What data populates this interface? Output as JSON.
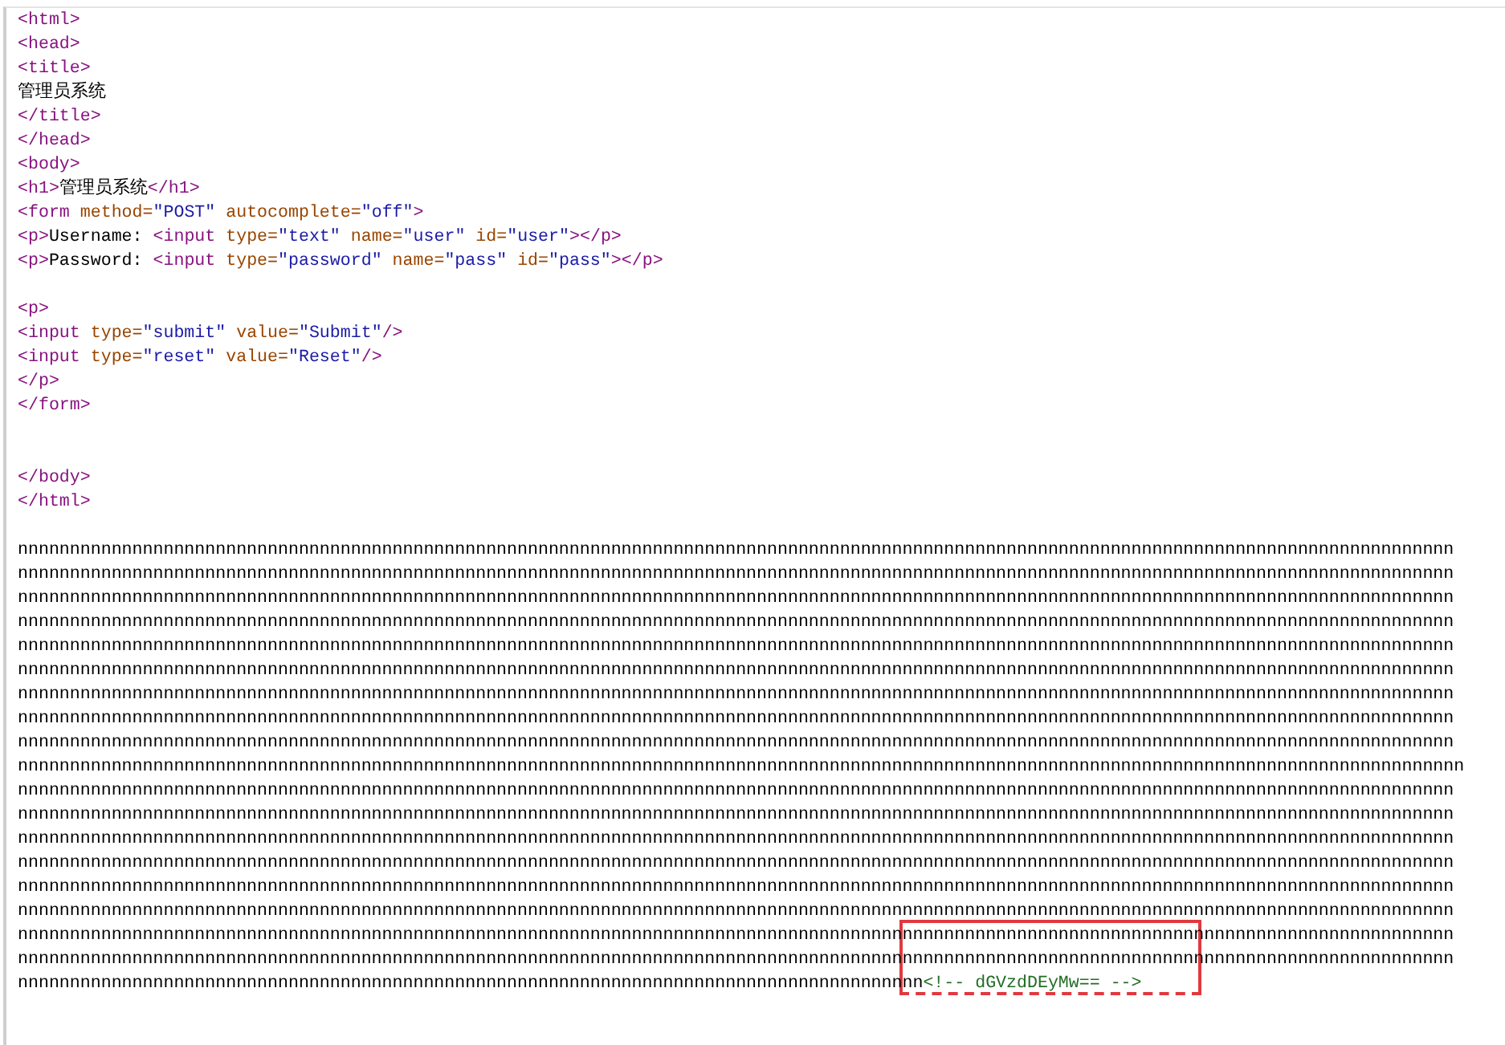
{
  "source_lines": [
    {
      "kind": "code",
      "tokens": [
        {
          "kind": "tag",
          "text": "<html>"
        }
      ]
    },
    {
      "kind": "code",
      "tokens": [
        {
          "kind": "tag",
          "text": "<head>"
        }
      ]
    },
    {
      "kind": "code",
      "tokens": [
        {
          "kind": "tag",
          "text": "<title>"
        }
      ]
    },
    {
      "kind": "code",
      "tokens": [
        {
          "kind": "text",
          "text": "管理员系统"
        }
      ]
    },
    {
      "kind": "code",
      "tokens": [
        {
          "kind": "tag",
          "text": "</title>"
        }
      ]
    },
    {
      "kind": "code",
      "tokens": [
        {
          "kind": "tag",
          "text": "</head>"
        }
      ]
    },
    {
      "kind": "code",
      "tokens": [
        {
          "kind": "tag",
          "text": "<body>"
        }
      ]
    },
    {
      "kind": "code",
      "tokens": [
        {
          "kind": "tag",
          "text": "<h1>"
        },
        {
          "kind": "text",
          "text": "管理员系统"
        },
        {
          "kind": "tag",
          "text": "</h1>"
        }
      ]
    },
    {
      "kind": "code",
      "tokens": [
        {
          "kind": "tag",
          "text": "<form "
        },
        {
          "kind": "attr",
          "text": "method="
        },
        {
          "kind": "value",
          "text": "\"POST\""
        },
        {
          "kind": "attr",
          "text": " autocomplete="
        },
        {
          "kind": "value",
          "text": "\"off\""
        },
        {
          "kind": "tag",
          "text": ">"
        }
      ]
    },
    {
      "kind": "code",
      "tokens": [
        {
          "kind": "tag",
          "text": "<p>"
        },
        {
          "kind": "text",
          "text": "Username: "
        },
        {
          "kind": "tag",
          "text": "<input "
        },
        {
          "kind": "attr",
          "text": "type="
        },
        {
          "kind": "value",
          "text": "\"text\""
        },
        {
          "kind": "attr",
          "text": " name="
        },
        {
          "kind": "value",
          "text": "\"user\""
        },
        {
          "kind": "attr",
          "text": " id="
        },
        {
          "kind": "value",
          "text": "\"user\""
        },
        {
          "kind": "tag",
          "text": "></p>"
        }
      ]
    },
    {
      "kind": "code",
      "tokens": [
        {
          "kind": "tag",
          "text": "<p>"
        },
        {
          "kind": "text",
          "text": "Password: "
        },
        {
          "kind": "tag",
          "text": "<input "
        },
        {
          "kind": "attr",
          "text": "type="
        },
        {
          "kind": "value",
          "text": "\"password\""
        },
        {
          "kind": "attr",
          "text": " name="
        },
        {
          "kind": "value",
          "text": "\"pass\""
        },
        {
          "kind": "attr",
          "text": " id="
        },
        {
          "kind": "value",
          "text": "\"pass\""
        },
        {
          "kind": "tag",
          "text": "></p>"
        }
      ]
    },
    {
      "kind": "blank"
    },
    {
      "kind": "code",
      "tokens": [
        {
          "kind": "tag",
          "text": "<p>"
        }
      ]
    },
    {
      "kind": "code",
      "tokens": [
        {
          "kind": "tag",
          "text": "<input "
        },
        {
          "kind": "attr",
          "text": "type="
        },
        {
          "kind": "value",
          "text": "\"submit\""
        },
        {
          "kind": "attr",
          "text": " value="
        },
        {
          "kind": "value",
          "text": "\"Submit\""
        },
        {
          "kind": "tag",
          "text": "/>"
        }
      ]
    },
    {
      "kind": "code",
      "tokens": [
        {
          "kind": "tag",
          "text": "<input "
        },
        {
          "kind": "attr",
          "text": "type="
        },
        {
          "kind": "value",
          "text": "\"reset\""
        },
        {
          "kind": "attr",
          "text": " value="
        },
        {
          "kind": "value",
          "text": "\"Reset\""
        },
        {
          "kind": "tag",
          "text": "/>"
        }
      ]
    },
    {
      "kind": "code",
      "tokens": [
        {
          "kind": "tag",
          "text": "</p>"
        }
      ]
    },
    {
      "kind": "code",
      "tokens": [
        {
          "kind": "tag",
          "text": "</form>"
        }
      ]
    },
    {
      "kind": "blank"
    },
    {
      "kind": "blank"
    },
    {
      "kind": "code",
      "tokens": [
        {
          "kind": "tag",
          "text": "</body>"
        }
      ]
    },
    {
      "kind": "code",
      "tokens": [
        {
          "kind": "tag",
          "text": "</html>"
        }
      ]
    },
    {
      "kind": "blank"
    },
    {
      "kind": "code",
      "tokens": [
        {
          "kind": "text",
          "text": "nnnnnnnnnnnnnnnnnnnnnnnnnnnnnnnnnnnnnnnnnnnnnnnnnnnnnnnnnnnnnnnnnnnnnnnnnnnnnnnnnnnnnnnnnnnnnnnnnnnnnnnnnnnnnnnnnnnnnnnnnnnnnnnnnnnnnnnnnn"
        }
      ]
    },
    {
      "kind": "code",
      "tokens": [
        {
          "kind": "text",
          "text": "nnnnnnnnnnnnnnnnnnnnnnnnnnnnnnnnnnnnnnnnnnnnnnnnnnnnnnnnnnnnnnnnnnnnnnnnnnnnnnnnnnnnnnnnnnnnnnnnnnnnnnnnnnnnnnnnnnnnnnnnnnnnnnnnnnnnnnnnnn"
        }
      ]
    },
    {
      "kind": "code",
      "tokens": [
        {
          "kind": "text",
          "text": "nnnnnnnnnnnnnnnnnnnnnnnnnnnnnnnnnnnnnnnnnnnnnnnnnnnnnnnnnnnnnnnnnnnnnnnnnnnnnnnnnnnnnnnnnnnnnnnnnnnnnnnnnnnnnnnnnnnnnnnnnnnnnnnnnnnnnnnnnn"
        }
      ]
    },
    {
      "kind": "code",
      "tokens": [
        {
          "kind": "text",
          "text": "nnnnnnnnnnnnnnnnnnnnnnnnnnnnnnnnnnnnnnnnnnnnnnnnnnnnnnnnnnnnnnnnnnnnnnnnnnnnnnnnnnnnnnnnnnnnnnnnnnnnnnnnnnnnnnnnnnnnnnnnnnnnnnnnnnnnnnnnnn"
        }
      ]
    },
    {
      "kind": "code",
      "tokens": [
        {
          "kind": "text",
          "text": "nnnnnnnnnnnnnnnnnnnnnnnnnnnnnnnnnnnnnnnnnnnnnnnnnnnnnnnnnnnnnnnnnnnnnnnnnnnnnnnnnnnnnnnnnnnnnnnnnnnnnnnnnnnnnnnnnnnnnnnnnnnnnnnnnnnnnnnnnn"
        }
      ]
    },
    {
      "kind": "code",
      "tokens": [
        {
          "kind": "text",
          "text": "nnnnnnnnnnnnnnnnnnnnnnnnnnnnnnnnnnnnnnnnnnnnnnnnnnnnnnnnnnnnnnnnnnnnnnnnnnnnnnnnnnnnnnnnnnnnnnnnnnnnnnnnnnnnnnnnnnnnnnnnnnnnnnnnnnnnnnnnnn"
        }
      ]
    },
    {
      "kind": "code",
      "tokens": [
        {
          "kind": "text",
          "text": "nnnnnnnnnnnnnnnnnnnnnnnnnnnnnnnnnnnnnnnnnnnnnnnnnnnnnnnnnnnnnnnnnnnnnnnnnnnnnnnnnnnnnnnnnnnnnnnnnnnnnnnnnnnnnnnnnnnnnnnnnnnnnnnnnnnnnnnnnn"
        }
      ]
    },
    {
      "kind": "code",
      "tokens": [
        {
          "kind": "text",
          "text": "nnnnnnnnnnnnnnnnnnnnnnnnnnnnnnnnnnnnnnnnnnnnnnnnnnnnnnnnnnnnnnnnnnnnnnnnnnnnnnnnnnnnnnnnnnnnnnnnnnnnnnnnnnnnnnnnnnnnnnnnnnnnnnnnnnnnnnnnnn"
        }
      ]
    },
    {
      "kind": "code",
      "tokens": [
        {
          "kind": "text",
          "text": "nnnnnnnnnnnnnnnnnnnnnnnnnnnnnnnnnnnnnnnnnnnnnnnnnnnnnnnnnnnnnnnnnnnnnnnnnnnnnnnnnnnnnnnnnnnnnnnnnnnnnnnnnnnnnnnnnnnnnnnnnnnnnnnnnnnnnnnnnn"
        }
      ]
    },
    {
      "kind": "code",
      "tokens": [
        {
          "kind": "text",
          "text": "nnnnnnnnnnnnnnnnnnnnnnnnnnnnnnnnnnnnnnnnnnnnnnnnnnnnnnnnnnnnnnnnnnnnnnnnnnnnnnnnnnnnnnnnnnnnnnnnnnnnnnnnnnnnnnnnnnnnnnnnnnnnnnnnnnnnnnnnnnn"
        }
      ]
    },
    {
      "kind": "code",
      "tokens": [
        {
          "kind": "text",
          "text": "nnnnnnnnnnnnnnnnnnnnnnnnnnnnnnnnnnnnnnnnnnnnnnnnnnnnnnnnnnnnnnnnnnnnnnnnnnnnnnnnnnnnnnnnnnnnnnnnnnnnnnnnnnnnnnnnnnnnnnnnnnnnnnnnnnnnnnnnnn"
        }
      ]
    },
    {
      "kind": "code",
      "tokens": [
        {
          "kind": "text",
          "text": "nnnnnnnnnnnnnnnnnnnnnnnnnnnnnnnnnnnnnnnnnnnnnnnnnnnnnnnnnnnnnnnnnnnnnnnnnnnnnnnnnnnnnnnnnnnnnnnnnnnnnnnnnnnnnnnnnnnnnnnnnnnnnnnnnnnnnnnnnn"
        }
      ]
    },
    {
      "kind": "code",
      "tokens": [
        {
          "kind": "text",
          "text": "nnnnnnnnnnnnnnnnnnnnnnnnnnnnnnnnnnnnnnnnnnnnnnnnnnnnnnnnnnnnnnnnnnnnnnnnnnnnnnnnnnnnnnnnnnnnnnnnnnnnnnnnnnnnnnnnnnnnnnnnnnnnnnnnnnnnnnnnnn"
        }
      ]
    },
    {
      "kind": "code",
      "tokens": [
        {
          "kind": "text",
          "text": "nnnnnnnnnnnnnnnnnnnnnnnnnnnnnnnnnnnnnnnnnnnnnnnnnnnnnnnnnnnnnnnnnnnnnnnnnnnnnnnnnnnnnnnnnnnnnnnnnnnnnnnnnnnnnnnnnnnnnnnnnnnnnnnnnnnnnnnnnn"
        }
      ]
    },
    {
      "kind": "code",
      "tokens": [
        {
          "kind": "text",
          "text": "nnnnnnnnnnnnnnnnnnnnnnnnnnnnnnnnnnnnnnnnnnnnnnnnnnnnnnnnnnnnnnnnnnnnnnnnnnnnnnnnnnnnnnnnnnnnnnnnnnnnnnnnnnnnnnnnnnnnnnnnnnnnnnnnnnnnnnnnnn"
        }
      ]
    },
    {
      "kind": "code",
      "tokens": [
        {
          "kind": "text",
          "text": "nnnnnnnnnnnnnnnnnnnnnnnnnnnnnnnnnnnnnnnnnnnnnnnnnnnnnnnnnnnnnnnnnnnnnnnnnnnnnnnnnnnnnnnnnnnnnnnnnnnnnnnnnnnnnnnnnnnnnnnnnnnnnnnnnnnnnnnnnn"
        }
      ]
    },
    {
      "kind": "code",
      "tokens": [
        {
          "kind": "text",
          "text": "nnnnnnnnnnnnnnnnnnnnnnnnnnnnnnnnnnnnnnnnnnnnnnnnnnnnnnnnnnnnnnnnnnnnnnnnnnnnnnnnnnnnnnnnnnnnnnnnnnnnnnnnnnnnnnnnnnnnnnnnnnnnnnnnnnnnnnnnnn"
        }
      ]
    },
    {
      "kind": "code",
      "tokens": [
        {
          "kind": "text",
          "text": "nnnnnnnnnnnnnnnnnnnnnnnnnnnnnnnnnnnnnnnnnnnnnnnnnnnnnnnnnnnnnnnnnnnnnnnnnnnnnnnnnnnnnnnnnnnnnnnnnnnnnnnnnnnnnnnnnnnnnnnnnnnnnnnnnnnnnnnnnn"
        }
      ]
    },
    {
      "kind": "code",
      "tokens": [
        {
          "kind": "text",
          "text": "nnnnnnnnnnnnnnnnnnnnnnnnnnnnnnnnnnnnnnnnnnnnnnnnnnnnnnnnnnnnnnnnnnnnnnnnnnnnnnnnnnnnnnn"
        },
        {
          "kind": "comment",
          "text": "<!-- dGVzdDEyMw== -->"
        }
      ]
    }
  ]
}
